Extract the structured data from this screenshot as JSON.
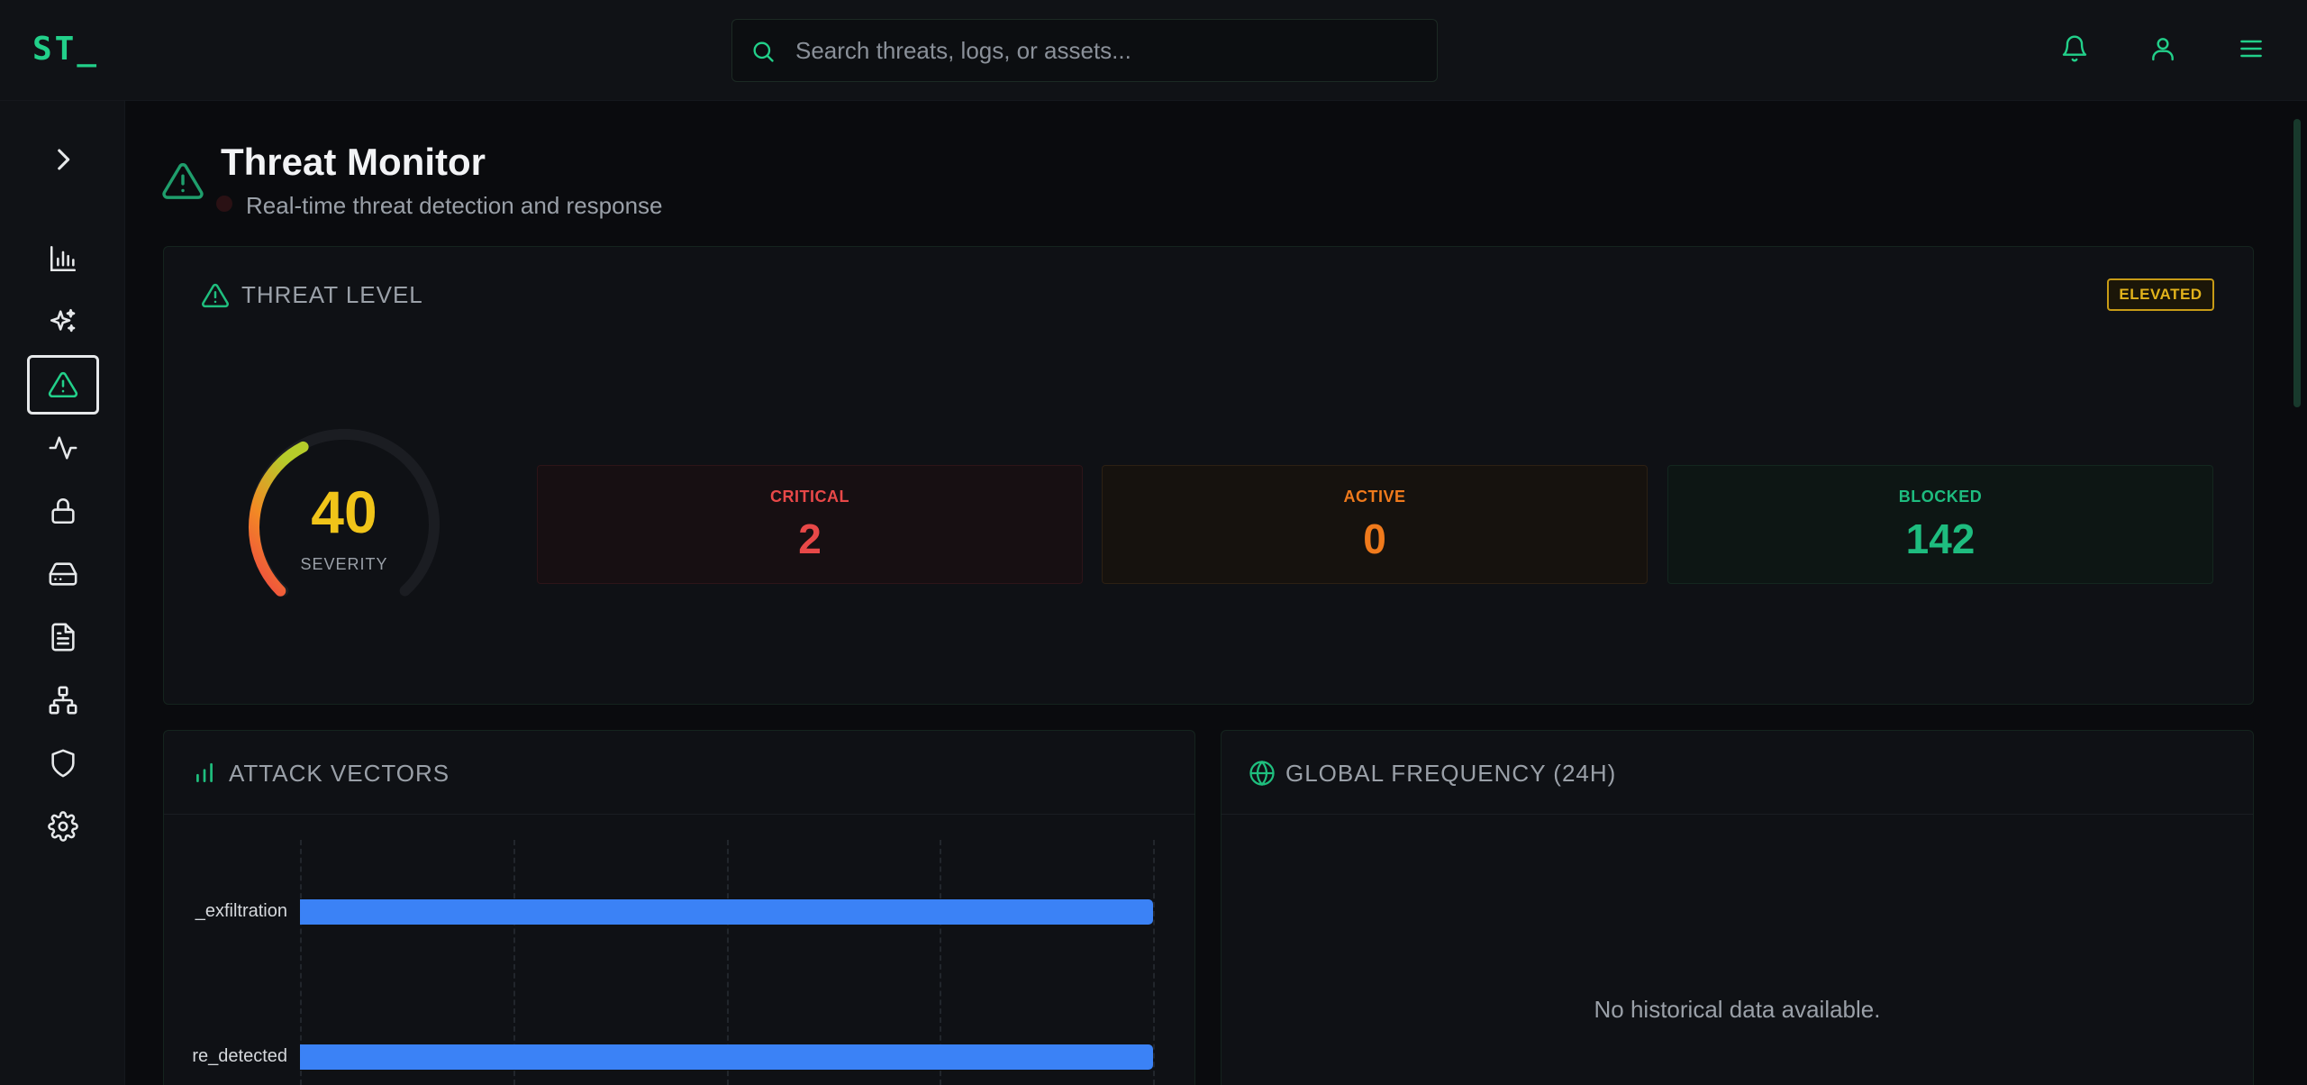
{
  "app": {
    "logo": "ST_"
  },
  "search": {
    "placeholder": "Search threats, logs, or assets..."
  },
  "topbar_icons": [
    "bell-icon",
    "user-icon",
    "menu-icon"
  ],
  "sidebar": {
    "expand_icon": "chevron-right-icon",
    "items": [
      {
        "name": "dashboard",
        "icon": "bar-chart-icon"
      },
      {
        "name": "ai-insights",
        "icon": "sparkles-icon"
      },
      {
        "name": "threat-monitor",
        "icon": "alert-triangle-icon",
        "active": true
      },
      {
        "name": "activity",
        "icon": "activity-icon"
      },
      {
        "name": "access",
        "icon": "lock-icon"
      },
      {
        "name": "storage",
        "icon": "hard-drive-icon"
      },
      {
        "name": "reports",
        "icon": "file-text-icon"
      },
      {
        "name": "network",
        "icon": "network-icon"
      },
      {
        "name": "security",
        "icon": "shield-icon"
      },
      {
        "name": "settings",
        "icon": "gear-icon"
      }
    ]
  },
  "page": {
    "title": "Threat Monitor",
    "subtitle": "Real-time threat detection and response"
  },
  "threat_level": {
    "title": "THREAT LEVEL",
    "badge": "ELEVATED",
    "gauge": {
      "value": "40",
      "label": "SEVERITY",
      "fraction": 0.4
    },
    "stats": {
      "critical": {
        "label": "CRITICAL",
        "value": "2"
      },
      "active": {
        "label": "ACTIVE",
        "value": "0"
      },
      "blocked": {
        "label": "BLOCKED",
        "value": "142"
      }
    }
  },
  "attack_vectors": {
    "title": "ATTACK VECTORS",
    "chart_data": {
      "type": "bar",
      "orientation": "horizontal",
      "categories": [
        "_exfiltration",
        "re_detected"
      ],
      "values": [
        1,
        1
      ],
      "grid": true
    }
  },
  "global_frequency": {
    "title": "GLOBAL FREQUENCY (24H)",
    "empty_message": "No historical data available."
  },
  "colors": {
    "accent": "#22d08a",
    "critical": "#e84848",
    "active": "#f07a1c",
    "blocked": "#1ebc7f",
    "elevated": "#e2b31c",
    "bar": "#3b82f6"
  }
}
